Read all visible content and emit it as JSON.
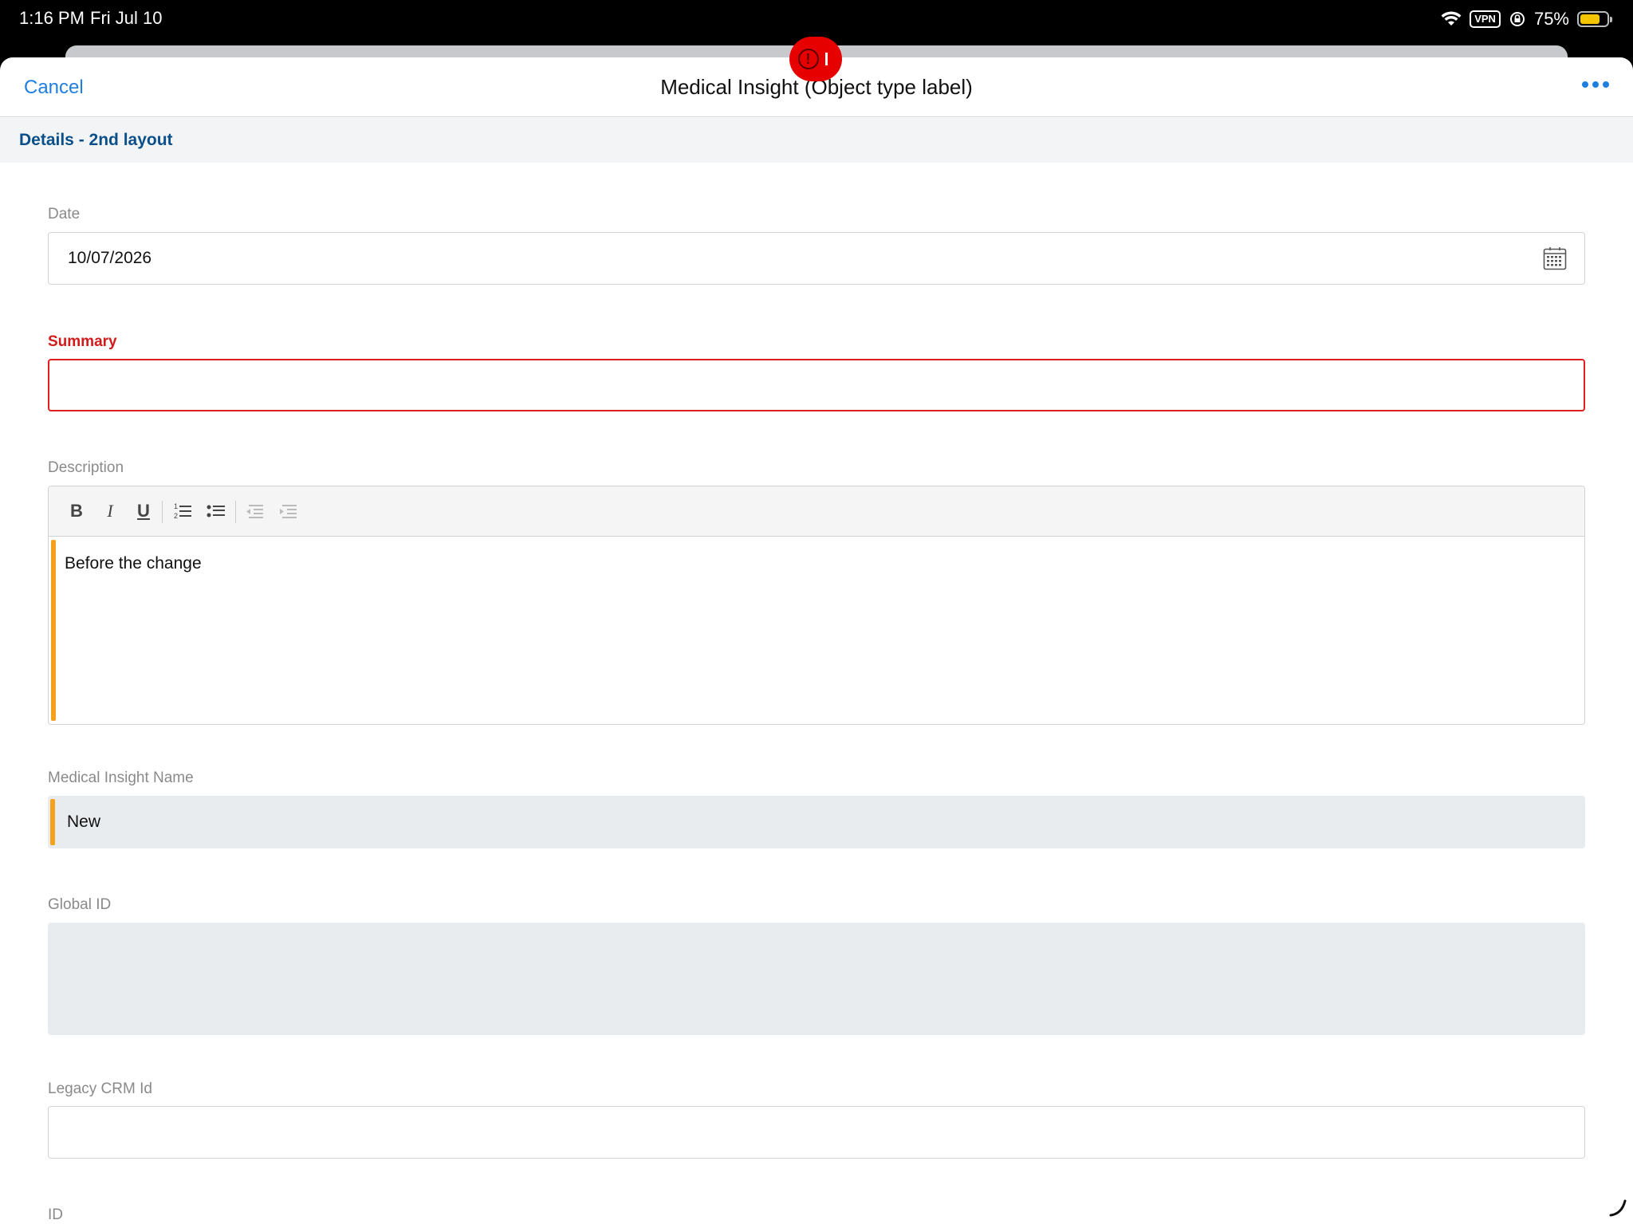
{
  "status_bar": {
    "time": "1:16 PM",
    "date": "Fri Jul 10",
    "vpn": "VPN",
    "battery": "75%",
    "battery_level": 0.75
  },
  "nav": {
    "cancel": "Cancel",
    "title": "Medical Insight (Object type label)",
    "more_icon": "ellipsis-icon"
  },
  "error_indicator": {
    "icon": "alert-icon",
    "text": "!"
  },
  "section": {
    "title": "Details - 2nd layout"
  },
  "fields": {
    "date": {
      "label": "Date",
      "value": "10/07/2026",
      "icon": "calendar-icon"
    },
    "summary": {
      "label": "Summary",
      "value": ""
    },
    "description": {
      "label": "Description",
      "text": "Before the change",
      "toolbar": {
        "bold": "B",
        "italic": "I",
        "underline": "U"
      }
    },
    "medical_insight_name": {
      "label": "Medical Insight Name",
      "value": "New"
    },
    "global_id": {
      "label": "Global ID",
      "value": ""
    },
    "legacy_crm_id": {
      "label": "Legacy CRM Id",
      "value": ""
    },
    "id": {
      "label": "ID"
    }
  },
  "colors": {
    "accent": "#1f7fe0",
    "section_title": "#0b4f8a",
    "error": "#e01e1e",
    "changed_marker": "#f4a11c"
  }
}
